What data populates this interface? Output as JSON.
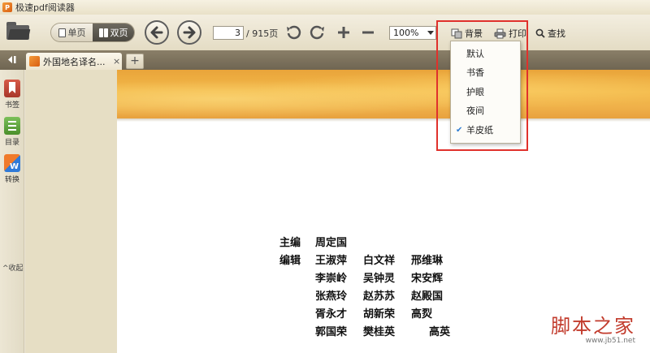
{
  "app": {
    "title": "极速pdf阅读器",
    "logo_text": "P"
  },
  "toolbar": {
    "view_single": "单页",
    "view_double": "双页",
    "page_current": "3",
    "page_total": "/ 915页",
    "zoom": "100%",
    "background_label": "背景",
    "print_label": "打印",
    "find_label": "查找"
  },
  "tabs": [
    {
      "label": "外国地名译名...",
      "close": "×"
    }
  ],
  "newtab_label": "+",
  "sidebar": {
    "items": [
      {
        "label": "书签",
        "icon": "bookmark-icon",
        "color": "#c54a3a"
      },
      {
        "label": "目录",
        "icon": "toc-icon",
        "color": "#5aa63a"
      },
      {
        "label": "转换",
        "icon": "convert-icon",
        "color": "#e8531e"
      }
    ],
    "collapse": "收起"
  },
  "background_menu": {
    "items": [
      "默认",
      "书香",
      "护眼",
      "夜间",
      "羊皮纸"
    ],
    "selected": "羊皮纸"
  },
  "document": {
    "credits": [
      {
        "role": "主编",
        "names": [
          "周定国"
        ]
      },
      {
        "role": "编辑",
        "names": [
          "王淑萍",
          "白文祥",
          "邢维琳"
        ]
      },
      {
        "role": "",
        "names": [
          "李崇岭",
          "吴钟灵",
          "宋安辉"
        ]
      },
      {
        "role": "",
        "names": [
          "张燕玲",
          "赵苏苏",
          "赵殿国"
        ]
      },
      {
        "role": "",
        "names": [
          "胥永才",
          "胡新荣",
          "高烮"
        ]
      },
      {
        "role": "",
        "names": [
          "郭国荣",
          "樊桂英",
          "高英"
        ]
      }
    ]
  },
  "watermark": {
    "main": "脚本之家",
    "sub": "www.jb51.net"
  },
  "colors": {
    "accent_red": "#e0312c",
    "check_blue": "#2d7bd3",
    "brand_orange": "#e8791e"
  }
}
